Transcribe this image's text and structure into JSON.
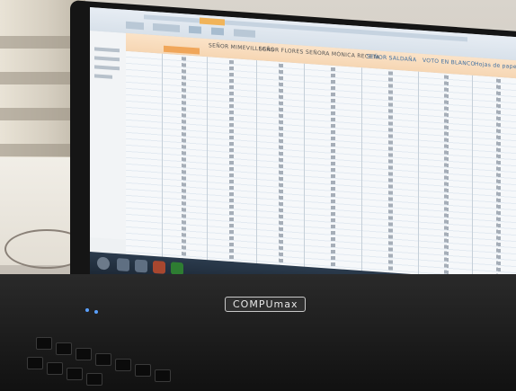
{
  "photo": {
    "subject": "laptop-screen-photo",
    "laptop": {
      "brand_label": "COMPUmax"
    },
    "screen": {
      "app": "spreadsheet",
      "columns": [
        {
          "key": "c1",
          "title": ""
        },
        {
          "key": "c2",
          "title": "SEÑOR MIMEVILLEGAS"
        },
        {
          "key": "c3",
          "title": "SEÑOR FLORES"
        },
        {
          "key": "c4",
          "title": "SEÑORA MÓNICA RECETA"
        },
        {
          "key": "c5",
          "title": "SEÑOR SALDAÑA"
        },
        {
          "key": "c6",
          "title": "VOTO EN BLANCO"
        },
        {
          "key": "c7",
          "title": "Hojas de papel rompe"
        }
      ]
    },
    "colors": {
      "header": "#f6d6b3",
      "highlight": "#f0a65a",
      "teal_band": "#9ccbd6",
      "taskbar": "#1b2633"
    }
  }
}
